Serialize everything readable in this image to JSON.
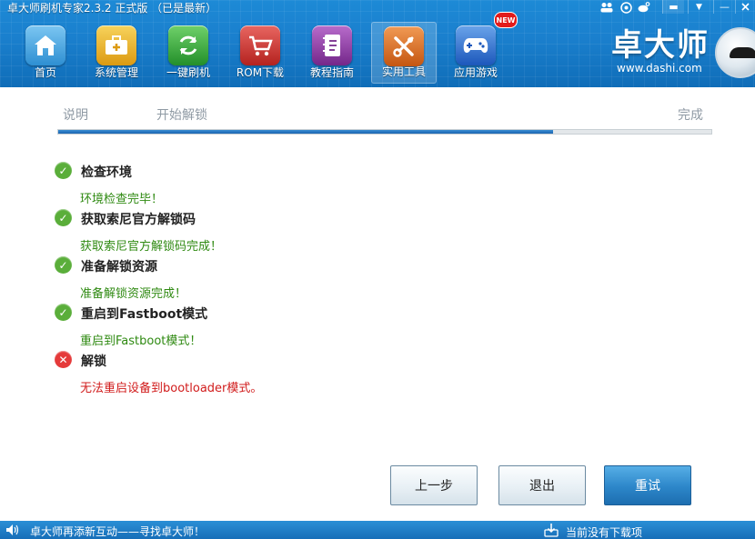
{
  "window": {
    "title": "卓大师刷机专家2.3.2 正式版 （已是最新）",
    "controls": {
      "menu_glyph": "▬",
      "dropdown_glyph": "▼",
      "minimize_glyph": "—"
    }
  },
  "toolbar": {
    "items": [
      {
        "label": "首页",
        "icon": "home-icon",
        "color": "#4aa7e0"
      },
      {
        "label": "系统管理",
        "icon": "toolbox-icon",
        "color": "#e9b22a"
      },
      {
        "label": "一键刷机",
        "icon": "refresh-icon",
        "color": "#37a63a"
      },
      {
        "label": "ROM下载",
        "icon": "cart-icon",
        "color": "#c7332f"
      },
      {
        "label": "教程指南",
        "icon": "book-icon",
        "color": "#8b3b9c"
      },
      {
        "label": "实用工具",
        "icon": "tools-icon",
        "color": "#d86d1f",
        "active": true
      },
      {
        "label": "应用游戏",
        "icon": "gamepad-icon",
        "color": "#2a6fd0"
      }
    ],
    "new_badge": "NEW"
  },
  "brand": {
    "name": "卓大师",
    "url": "www.dashi.com"
  },
  "steps": {
    "labels": [
      "说明",
      "开始解锁",
      "完成"
    ],
    "progress": 0.758
  },
  "tasks": [
    {
      "title": "检查环境",
      "detail": "环境检查完毕！",
      "status": "ok"
    },
    {
      "title": "获取索尼官方解锁码",
      "detail": "获取索尼官方解锁码完成！",
      "status": "ok"
    },
    {
      "title": "准备解锁资源",
      "detail": "准备解锁资源完成！",
      "status": "ok"
    },
    {
      "title": "重启到Fastboot模式",
      "detail": "重启到Fastboot模式！",
      "status": "ok"
    },
    {
      "title": "解锁",
      "detail": "无法重启设备到bootloader模式。",
      "status": "error"
    }
  ],
  "buttons": {
    "prev": "上一步",
    "exit": "退出",
    "retry": "重试"
  },
  "statusbar": {
    "message": "卓大师再添新互动——寻找卓大师！",
    "download_status": "当前没有下载项"
  },
  "colors": {
    "header": "#1a7fcd",
    "ok": "#5aae3a",
    "error": "#e53a3a",
    "progress": "#1b64b0"
  }
}
